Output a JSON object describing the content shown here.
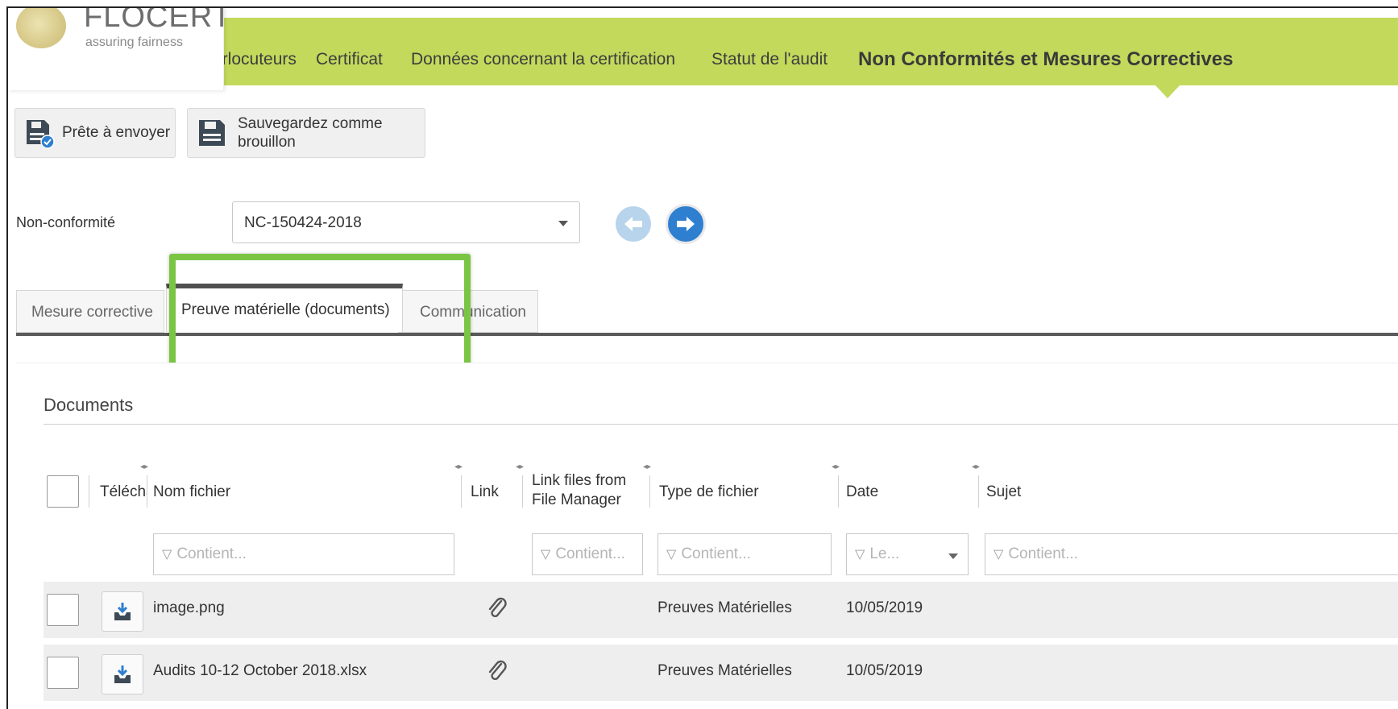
{
  "logo": {
    "brand": "FLOCERT",
    "tagline": "assuring fairness"
  },
  "nav": {
    "tabs": [
      {
        "label": "erlocuteurs"
      },
      {
        "label": "Certificat"
      },
      {
        "label": "Données concernant la certification"
      },
      {
        "label": "Statut de l'audit"
      },
      {
        "label": "Non Conformités et Mesures Correctives"
      }
    ],
    "active": "Non Conformités et Mesures Correctives"
  },
  "toolbar": {
    "ready_label": "Prête à envoyer",
    "draft_label": "Sauvegardez comme brouillon"
  },
  "nonconformity": {
    "label": "Non-conformité",
    "selected": "NC-150424-2018"
  },
  "subtabs": [
    {
      "label": "Mesure corrective"
    },
    {
      "label": "Preuve matérielle (documents)"
    },
    {
      "label": "Communication"
    }
  ],
  "documents": {
    "title": "Documents",
    "columns": {
      "download": "Télécha",
      "filename": "Nom fichier",
      "link": "Link",
      "link_files_1": "Link files from",
      "link_files_2": "File Manager",
      "type": "Type de fichier",
      "date": "Date",
      "subject": "Sujet"
    },
    "filters": {
      "contains": "Contient...",
      "date": "Le..."
    },
    "rows": [
      {
        "filename": "image.png",
        "type": "Preuves Matérielles",
        "date": "10/05/2019"
      },
      {
        "filename": "Audits 10-12 October 2018.xlsx",
        "type": "Preuves Matérielles",
        "date": "10/05/2019"
      }
    ]
  },
  "colors": {
    "nav_green": "#c2d95c",
    "highlight_green": "#7bc544",
    "accent_blue": "#2e7fd0"
  }
}
